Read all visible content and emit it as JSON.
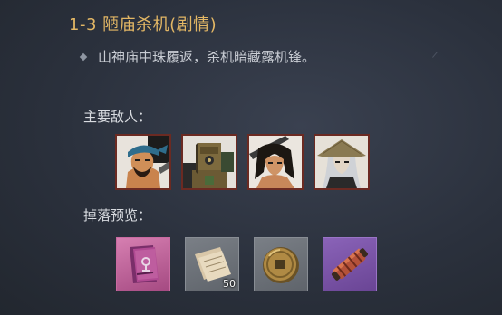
{
  "stage": {
    "title": "1-3 陋庙杀机(剧情)",
    "description": "山神庙中珠履返，杀机暗藏露机锋。"
  },
  "enemies": {
    "label": "主要敌人：",
    "items": [
      {
        "icon": "bandana-brute-portrait-icon"
      },
      {
        "icon": "wooden-automaton-portrait-icon"
      },
      {
        "icon": "long-haired-swordsman-portrait-icon"
      },
      {
        "icon": "straw-hat-assassin-portrait-icon"
      }
    ]
  },
  "drops": {
    "label": "掉落预览：",
    "items": [
      {
        "icon": "purple-manual-book-icon",
        "rarity_color": "#c86aa0"
      },
      {
        "icon": "paper-scrolls-icon",
        "rarity_color": "#80858c",
        "count": "50"
      },
      {
        "icon": "bronze-coin-icon",
        "rarity_color": "#80858c"
      },
      {
        "icon": "bamboo-scroll-icon",
        "rarity_color": "#8a63b8"
      }
    ]
  },
  "colors": {
    "title": "#e3b765",
    "text": "#c9cdd4",
    "enemy_border": "#6b2a22"
  }
}
